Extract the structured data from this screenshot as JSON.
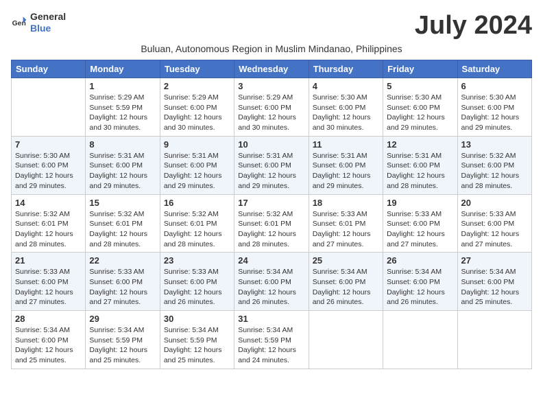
{
  "header": {
    "logo_line1": "General",
    "logo_line2": "Blue",
    "month_title": "July 2024",
    "subtitle": "Buluan, Autonomous Region in Muslim Mindanao, Philippines"
  },
  "days_of_week": [
    "Sunday",
    "Monday",
    "Tuesday",
    "Wednesday",
    "Thursday",
    "Friday",
    "Saturday"
  ],
  "weeks": [
    [
      {
        "num": "",
        "info": ""
      },
      {
        "num": "1",
        "info": "Sunrise: 5:29 AM\nSunset: 5:59 PM\nDaylight: 12 hours\nand 30 minutes."
      },
      {
        "num": "2",
        "info": "Sunrise: 5:29 AM\nSunset: 6:00 PM\nDaylight: 12 hours\nand 30 minutes."
      },
      {
        "num": "3",
        "info": "Sunrise: 5:29 AM\nSunset: 6:00 PM\nDaylight: 12 hours\nand 30 minutes."
      },
      {
        "num": "4",
        "info": "Sunrise: 5:30 AM\nSunset: 6:00 PM\nDaylight: 12 hours\nand 30 minutes."
      },
      {
        "num": "5",
        "info": "Sunrise: 5:30 AM\nSunset: 6:00 PM\nDaylight: 12 hours\nand 29 minutes."
      },
      {
        "num": "6",
        "info": "Sunrise: 5:30 AM\nSunset: 6:00 PM\nDaylight: 12 hours\nand 29 minutes."
      }
    ],
    [
      {
        "num": "7",
        "info": "Sunrise: 5:30 AM\nSunset: 6:00 PM\nDaylight: 12 hours\nand 29 minutes."
      },
      {
        "num": "8",
        "info": "Sunrise: 5:31 AM\nSunset: 6:00 PM\nDaylight: 12 hours\nand 29 minutes."
      },
      {
        "num": "9",
        "info": "Sunrise: 5:31 AM\nSunset: 6:00 PM\nDaylight: 12 hours\nand 29 minutes."
      },
      {
        "num": "10",
        "info": "Sunrise: 5:31 AM\nSunset: 6:00 PM\nDaylight: 12 hours\nand 29 minutes."
      },
      {
        "num": "11",
        "info": "Sunrise: 5:31 AM\nSunset: 6:00 PM\nDaylight: 12 hours\nand 29 minutes."
      },
      {
        "num": "12",
        "info": "Sunrise: 5:31 AM\nSunset: 6:00 PM\nDaylight: 12 hours\nand 28 minutes."
      },
      {
        "num": "13",
        "info": "Sunrise: 5:32 AM\nSunset: 6:00 PM\nDaylight: 12 hours\nand 28 minutes."
      }
    ],
    [
      {
        "num": "14",
        "info": "Sunrise: 5:32 AM\nSunset: 6:01 PM\nDaylight: 12 hours\nand 28 minutes."
      },
      {
        "num": "15",
        "info": "Sunrise: 5:32 AM\nSunset: 6:01 PM\nDaylight: 12 hours\nand 28 minutes."
      },
      {
        "num": "16",
        "info": "Sunrise: 5:32 AM\nSunset: 6:01 PM\nDaylight: 12 hours\nand 28 minutes."
      },
      {
        "num": "17",
        "info": "Sunrise: 5:32 AM\nSunset: 6:01 PM\nDaylight: 12 hours\nand 28 minutes."
      },
      {
        "num": "18",
        "info": "Sunrise: 5:33 AM\nSunset: 6:01 PM\nDaylight: 12 hours\nand 27 minutes."
      },
      {
        "num": "19",
        "info": "Sunrise: 5:33 AM\nSunset: 6:00 PM\nDaylight: 12 hours\nand 27 minutes."
      },
      {
        "num": "20",
        "info": "Sunrise: 5:33 AM\nSunset: 6:00 PM\nDaylight: 12 hours\nand 27 minutes."
      }
    ],
    [
      {
        "num": "21",
        "info": "Sunrise: 5:33 AM\nSunset: 6:00 PM\nDaylight: 12 hours\nand 27 minutes."
      },
      {
        "num": "22",
        "info": "Sunrise: 5:33 AM\nSunset: 6:00 PM\nDaylight: 12 hours\nand 27 minutes."
      },
      {
        "num": "23",
        "info": "Sunrise: 5:33 AM\nSunset: 6:00 PM\nDaylight: 12 hours\nand 26 minutes."
      },
      {
        "num": "24",
        "info": "Sunrise: 5:34 AM\nSunset: 6:00 PM\nDaylight: 12 hours\nand 26 minutes."
      },
      {
        "num": "25",
        "info": "Sunrise: 5:34 AM\nSunset: 6:00 PM\nDaylight: 12 hours\nand 26 minutes."
      },
      {
        "num": "26",
        "info": "Sunrise: 5:34 AM\nSunset: 6:00 PM\nDaylight: 12 hours\nand 26 minutes."
      },
      {
        "num": "27",
        "info": "Sunrise: 5:34 AM\nSunset: 6:00 PM\nDaylight: 12 hours\nand 25 minutes."
      }
    ],
    [
      {
        "num": "28",
        "info": "Sunrise: 5:34 AM\nSunset: 6:00 PM\nDaylight: 12 hours\nand 25 minutes."
      },
      {
        "num": "29",
        "info": "Sunrise: 5:34 AM\nSunset: 5:59 PM\nDaylight: 12 hours\nand 25 minutes."
      },
      {
        "num": "30",
        "info": "Sunrise: 5:34 AM\nSunset: 5:59 PM\nDaylight: 12 hours\nand 25 minutes."
      },
      {
        "num": "31",
        "info": "Sunrise: 5:34 AM\nSunset: 5:59 PM\nDaylight: 12 hours\nand 24 minutes."
      },
      {
        "num": "",
        "info": ""
      },
      {
        "num": "",
        "info": ""
      },
      {
        "num": "",
        "info": ""
      }
    ]
  ]
}
